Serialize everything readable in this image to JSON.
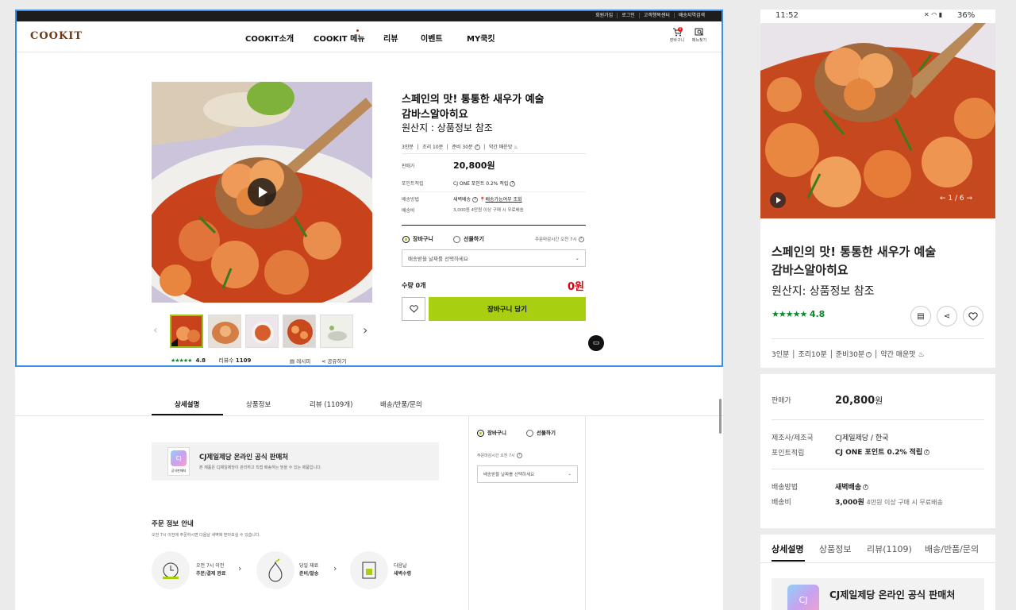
{
  "topbar": {
    "links": [
      "회원가입",
      "로그인",
      "고객행복센터",
      "배송지역검색"
    ]
  },
  "header": {
    "logo": "COOKIT",
    "nav": [
      "COOKIT소개",
      "COOKIT 메뉴",
      "리뷰",
      "이벤트",
      "MY쿡킷"
    ],
    "cart_label": "장바구니",
    "cart_count": "0",
    "menu_search_label": "메뉴찾기"
  },
  "product": {
    "title_line1": "스페인의 맛! 통통한 새우가 예술",
    "title_line2": "감바스알아히요",
    "origin": "원산지 : 상품정보 참조",
    "servings": "3인분",
    "cook_time": "조리 10분",
    "prep_time": "준비 30분",
    "spice": "약간 매운맛",
    "price_label": "판매가",
    "price": "20,800원",
    "points_label": "포인트적립",
    "points": "CJ ONE 포인트 0.2% 적립",
    "delivery_method_label": "배송방법",
    "delivery_method": "새벽배송",
    "delivery_check": "배송가능여부 조회",
    "shipping_fee_label": "배송비",
    "shipping_fee": "3,000원  4만원 이상 구매 시 무료배송",
    "radio_cart": "장바구니",
    "radio_gift": "선물하기",
    "order_deadline": "주문마감시간 오전 7시",
    "date_select_placeholder": "배송받을 날짜를 선택하세요",
    "qty_label": "수량 0개",
    "total": "0원",
    "add_to_cart": "장바구니 담기",
    "rating": "4.8",
    "review_count_label": "리뷰수",
    "review_count": "1109",
    "recipe_label": "레시피",
    "share_label": "공유하기"
  },
  "tabs": [
    "상세설명",
    "상품정보",
    "리뷰 (1109개)",
    "배송/반품/문의"
  ],
  "seller": {
    "title": "CJ제일제당 온라인 공식 판매처",
    "desc": "본 제품은 CJ제일제당이 관리하고 직접 배송하는 믿을 수 있는 제품입니다.",
    "badge": "공식판매처",
    "logo_text": "CJ"
  },
  "order_info": {
    "title": "주문 정보 안내",
    "desc": "오전 7시 이전에 주문하시면 다음날 새벽에 받아보실 수 있습니다.",
    "steps": [
      {
        "line1": "오전 7시 이전",
        "line2": "주문/결제 완료"
      },
      {
        "line1": "당일 재료",
        "line2": "준비/발송"
      },
      {
        "line1": "다음날",
        "line2": "새벽수령"
      }
    ]
  },
  "sidebar": {
    "radio_cart": "장바구니",
    "radio_gift": "선물하기",
    "order_deadline": "주문마감시간 오전 7시",
    "date_select_placeholder": "배송받을 날짜를 선택하세요"
  },
  "mobile": {
    "status_time": "11:52",
    "battery": "36%",
    "image_counter": "1 / 6",
    "title_line1": "스페인의 맛! 통통한 새우가 예술",
    "title_line2": "감바스알아히요",
    "origin": "원산지: 상품정보 참조",
    "rating": "4.8",
    "meta": [
      "3인분",
      "조리10분",
      "준비30분",
      "약간 매운맛"
    ],
    "price_label": "판매가",
    "price_num": "20,800",
    "price_unit": "원",
    "maker_label": "제조사/제조국",
    "maker": "CJ제일제당 / 한국",
    "points_label": "포인트적립",
    "points": "CJ ONE 포인트 0.2% 적립",
    "delivery_label": "배송방법",
    "delivery": "새벽배송",
    "fee_label": "배송비",
    "fee": "3,000원",
    "fee_note": "4만원 이상 구매 시 무료배송",
    "tabs": [
      "상세설명",
      "상품정보",
      "리뷰(1109)",
      "배송/반품/문의"
    ],
    "seller_title": "CJ제일제당 온라인 공식 판매처",
    "logo_text": "CJ"
  },
  "colors": {
    "accent": "#a8d011",
    "price_red": "#e0000f",
    "star_green": "#0a8a2a",
    "selection_blue": "#3a8ee6"
  }
}
